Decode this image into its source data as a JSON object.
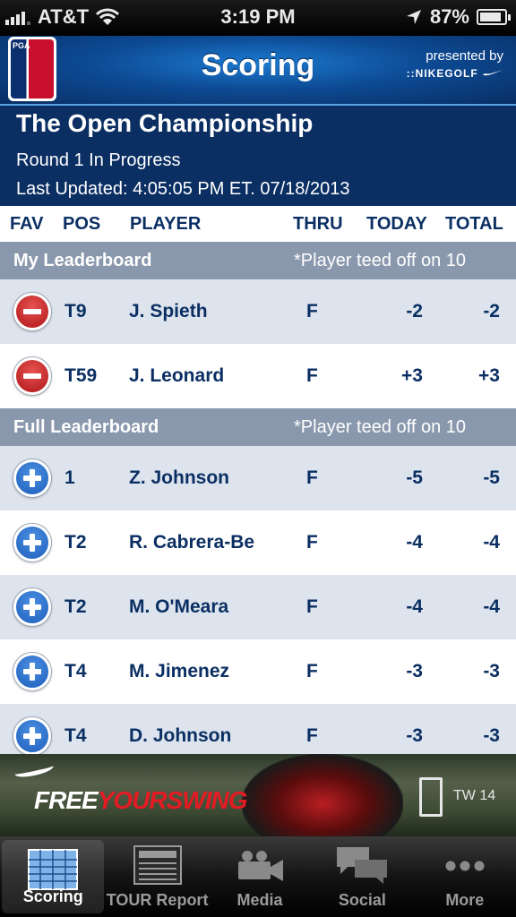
{
  "status": {
    "carrier": "AT&T",
    "time": "3:19 PM",
    "battery": "87%",
    "battery_level": 0.87
  },
  "header": {
    "title": "Scoring",
    "logo_top": "PGA",
    "logo_bottom": "TOUR",
    "presented_by": "presented by",
    "sponsor": "::NIKEGOLF"
  },
  "tournament": {
    "name": "The Open Championship",
    "round_status": "Round 1 In Progress",
    "last_updated": "Last Updated: 4:05:05 PM ET. 07/18/2013"
  },
  "columns": {
    "fav": "FAV",
    "pos": "POS",
    "player": "PLAYER",
    "thru": "THRU",
    "today": "TODAY",
    "total": "TOTAL"
  },
  "my_leaderboard": {
    "title": "My Leaderboard",
    "note": "*Player teed off on 10",
    "rows": [
      {
        "pos": "T9",
        "player": "J. Spieth",
        "thru": "F",
        "today": "-2",
        "total": "-2"
      },
      {
        "pos": "T59",
        "player": "J. Leonard",
        "thru": "F",
        "today": "+3",
        "total": "+3"
      }
    ]
  },
  "full_leaderboard": {
    "title": "Full Leaderboard",
    "note": "*Player teed off on 10",
    "rows": [
      {
        "pos": "1",
        "player": "Z. Johnson",
        "thru": "F",
        "today": "-5",
        "total": "-5"
      },
      {
        "pos": "T2",
        "player": "R. Cabrera-Be",
        "thru": "F",
        "today": "-4",
        "total": "-4"
      },
      {
        "pos": "T2",
        "player": "M. O'Meara",
        "thru": "F",
        "today": "-4",
        "total": "-4"
      },
      {
        "pos": "T4",
        "player": "M. Jimenez",
        "thru": "F",
        "today": "-3",
        "total": "-3"
      },
      {
        "pos": "T4",
        "player": "D. Johnson",
        "thru": "F",
        "today": "-3",
        "total": "-3"
      }
    ]
  },
  "ad": {
    "slogan_a": "FREE",
    "slogan_b": "YOURSWING",
    "product": "TW 14"
  },
  "tabs": [
    {
      "label": "Scoring",
      "icon": "scoreboard-icon",
      "active": true
    },
    {
      "label": "TOUR Report",
      "icon": "newspaper-icon",
      "active": false
    },
    {
      "label": "Media",
      "icon": "video-camera-icon",
      "active": false
    },
    {
      "label": "Social",
      "icon": "chat-bubbles-icon",
      "active": false
    },
    {
      "label": "More",
      "icon": "more-dots-icon",
      "active": false
    }
  ],
  "colors": {
    "navy": "#0b2f63",
    "section": "#8a98ad",
    "row_alt": "#dde4ed",
    "remove_red": "#c8102e",
    "add_blue": "#1e5fbd"
  }
}
